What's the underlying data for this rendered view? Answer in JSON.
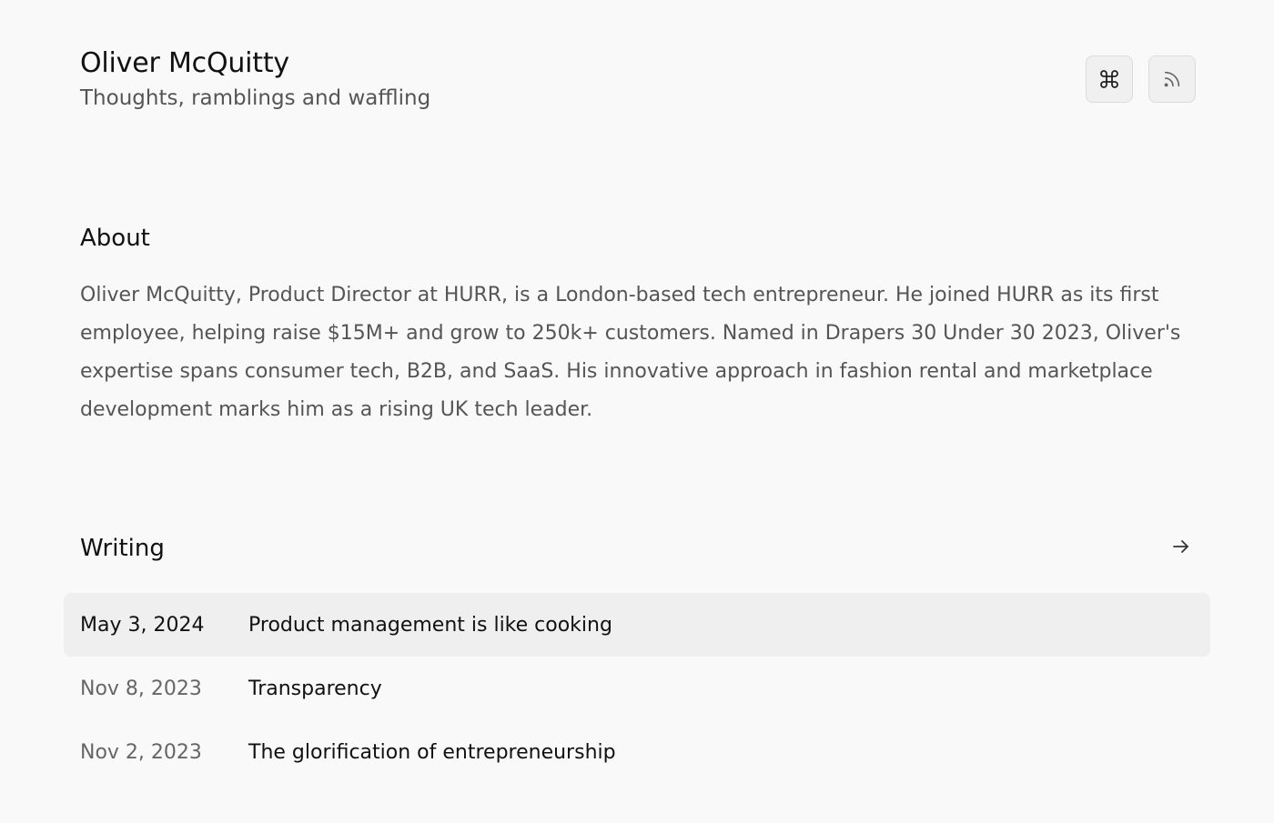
{
  "header": {
    "title": "Oliver McQuitty",
    "subtitle": "Thoughts, ramblings and waffling",
    "actions": [
      {
        "name": "command-menu-button",
        "icon": "command-icon"
      },
      {
        "name": "rss-feed-button",
        "icon": "rss-icon"
      }
    ]
  },
  "about": {
    "heading": "About",
    "text": "Oliver McQuitty, Product Director at HURR, is a London-based tech entrepreneur. He joined HURR as its first employee, helping raise $15M+ and grow to 250k+ customers. Named in Drapers 30 Under 30 2023, Oliver's expertise spans consumer tech, B2B, and SaaS. His innovative approach in fashion rental and marketplace development marks him as a rising UK tech leader."
  },
  "writing": {
    "heading": "Writing",
    "more_icon": "arrow-right-icon",
    "posts": [
      {
        "date": "May 3, 2024",
        "title": "Product management is like cooking"
      },
      {
        "date": "Nov 8, 2023",
        "title": "Transparency"
      },
      {
        "date": "Nov 2, 2023",
        "title": "The glorification of entrepreneurship"
      }
    ]
  },
  "colors": {
    "background": "#f9f9f9",
    "text_primary": "#111111",
    "text_secondary": "#555555",
    "row_highlight": "#efefef",
    "button_bg": "#f0f0f0",
    "button_border": "#dcdcdc"
  }
}
